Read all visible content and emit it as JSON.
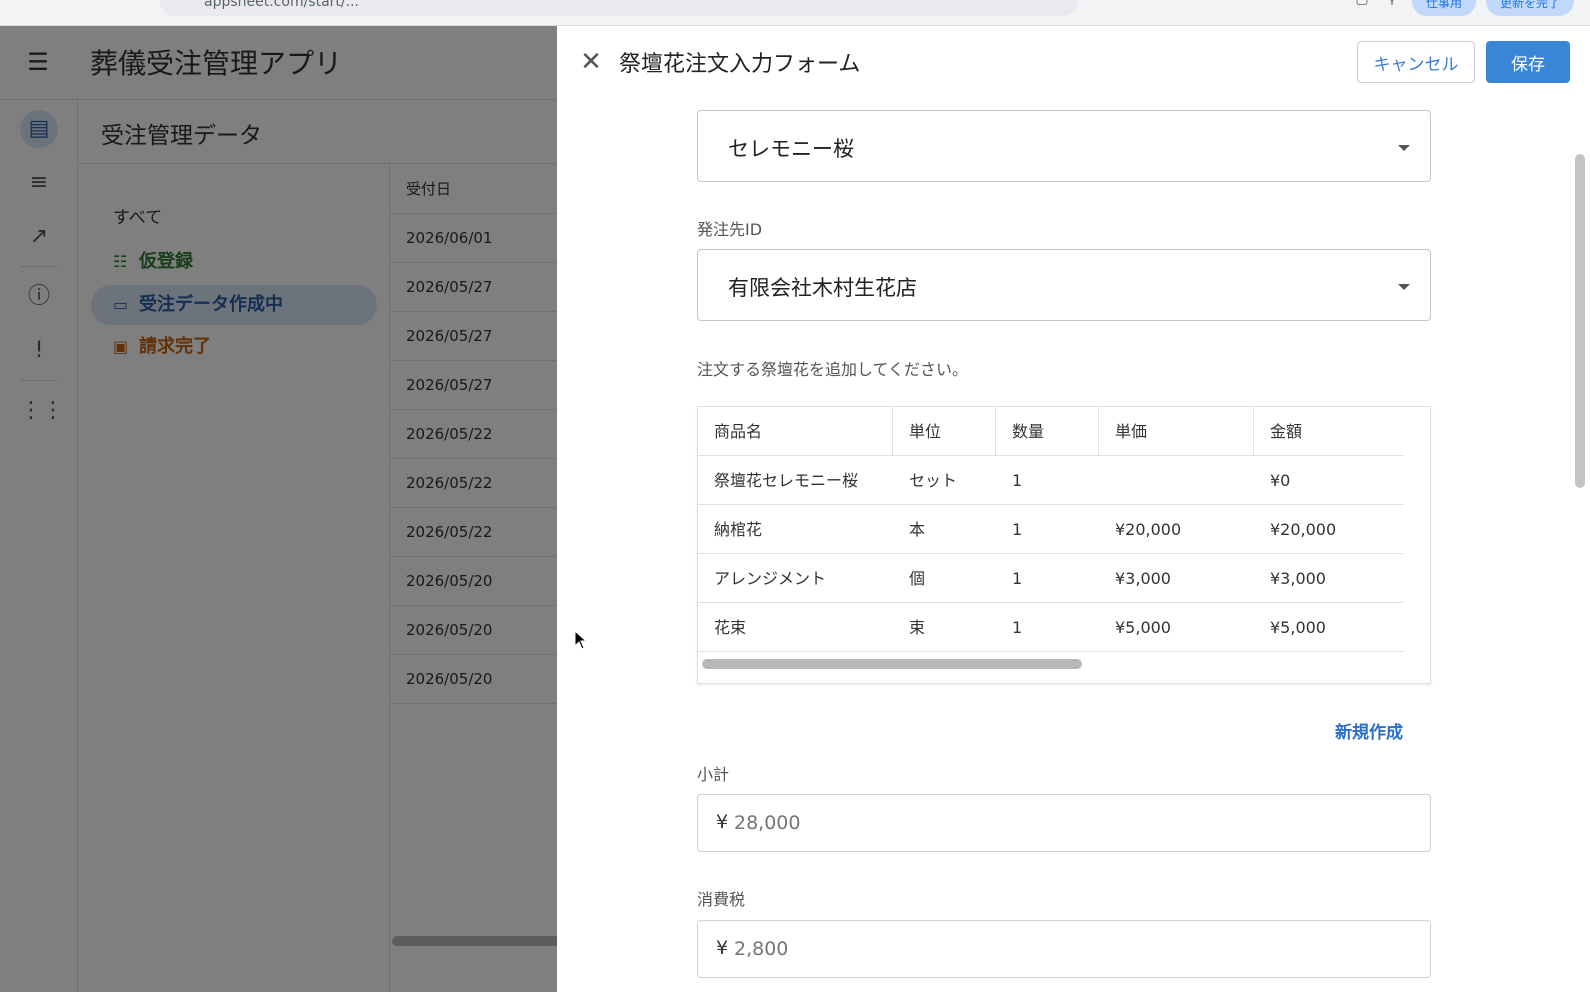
{
  "browser": {
    "url": "appsheet.com/start/...",
    "profile_label": "仕事用",
    "update_label": "更新を完了"
  },
  "app": {
    "title": "葬儀受注管理アプリ",
    "page_title": "受注管理データ",
    "filters": [
      {
        "label": "すべて",
        "icon": "none",
        "color": "#333333"
      },
      {
        "label": "仮登録",
        "icon": "checklist-icon",
        "color": "#2e7d32"
      },
      {
        "label": "受注データ作成中",
        "icon": "folder-icon",
        "color": "#2a5da8",
        "active": true
      },
      {
        "label": "請求完了",
        "icon": "clipboard-check-icon",
        "color": "#c9600a"
      }
    ],
    "column_header": "受付日",
    "dates": [
      "2026/06/01",
      "2026/05/27",
      "2026/05/27",
      "2026/05/27",
      "2026/05/22",
      "2026/05/22",
      "2026/05/22",
      "2026/05/20",
      "2026/05/20",
      "2026/05/20"
    ]
  },
  "form": {
    "title": "祭壇花注文入力フォーム",
    "cancel_label": "キャンセル",
    "save_label": "保存",
    "plan_select_value": "セレモニー桜",
    "vendor_label": "発注先ID",
    "vendor_value": "有限会社木村生花店",
    "help_text": "注文する祭壇花を追加してください。",
    "table": {
      "headers": [
        "商品名",
        "単位",
        "数量",
        "単価",
        "金額"
      ],
      "rows": [
        [
          "祭壇花セレモニー桜",
          "セット",
          "1",
          "",
          "¥0"
        ],
        [
          "納棺花",
          "本",
          "1",
          "¥20,000",
          "¥20,000"
        ],
        [
          "アレンジメント",
          "個",
          "1",
          "¥3,000",
          "¥3,000"
        ],
        [
          "花束",
          "束",
          "1",
          "¥5,000",
          "¥5,000"
        ]
      ]
    },
    "new_label": "新規作成",
    "subtotal_label": "小計",
    "subtotal_placeholder": "28,000",
    "tax_label": "消費税",
    "tax_placeholder": "2,800",
    "currency_symbol": "¥"
  },
  "colors": {
    "accent": "#3a86d6",
    "link": "#2a6fc9",
    "overlay": "rgba(0,0,0,0.5)"
  }
}
